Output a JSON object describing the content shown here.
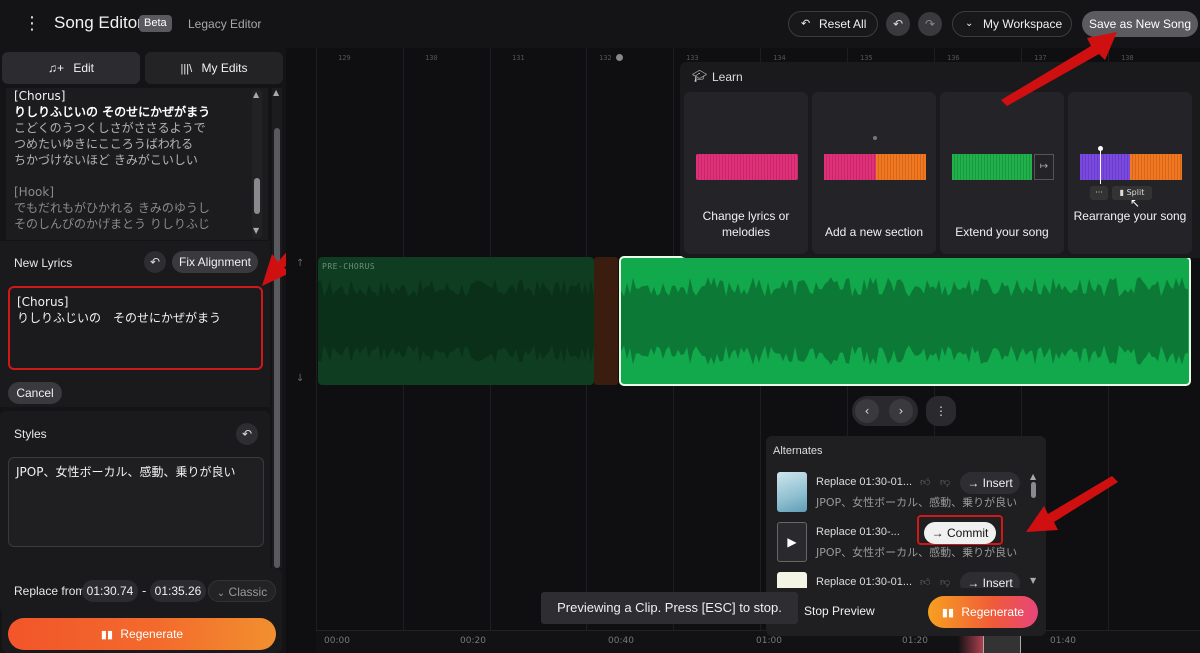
{
  "header": {
    "app_title": "Song Editor",
    "beta_badge": "Beta",
    "legacy_link": "Legacy Editor",
    "reset_all": "Reset All",
    "workspace": "My Workspace",
    "save_new": "Save as New Song"
  },
  "left": {
    "tab_edit": "Edit",
    "tab_my_edits": "My Edits",
    "lyrics": [
      {
        "text": "[Chorus]",
        "style": "active"
      },
      {
        "text": "りしりふじいの そのせにかぜがまう",
        "style": "active-bold"
      },
      {
        "text": "こどくのうつくしさがささるようで",
        "style": "dim"
      },
      {
        "text": "つめたいゆきにこころうばわれる",
        "style": "dim"
      },
      {
        "text": "ちかづけないほど きみがこいしい",
        "style": "dim"
      },
      {
        "text": "",
        "style": "dim"
      },
      {
        "text": "[Hook]",
        "style": "dimmer"
      },
      {
        "text": "でもだれもがひかれる きみのゆうし",
        "style": "dimmer"
      },
      {
        "text": "そのしんぴのかげまとう りしりふじ",
        "style": "dimmer"
      }
    ],
    "new_lyrics_label": "New Lyrics",
    "fix_alignment": "Fix Alignment",
    "new_lyrics_text": "[Chorus]\nりしりふじいの　そのせにかぜがまう",
    "cancel": "Cancel",
    "styles_label": "Styles",
    "styles_text": "JPOP、女性ボーカル、感動、乗りが良い",
    "replace_from_label": "Replace from",
    "replace_start": "01:30.74",
    "replace_dash": "-",
    "replace_end": "01:35.26",
    "mode": "Classic",
    "regenerate": "Regenerate"
  },
  "timeline": {
    "ruler_top": [
      "129",
      "130",
      "131",
      "132",
      "133",
      "134",
      "135",
      "136",
      "137",
      "138"
    ],
    "section_label": "PRE-CHORUS",
    "bottom_ticks": [
      "00:00",
      "00:20",
      "00:40",
      "01:00",
      "01:20",
      "01:40"
    ]
  },
  "learn": {
    "title": "Learn",
    "cards": [
      {
        "label": "Change lyrics or melodies"
      },
      {
        "label": "Add a new section"
      },
      {
        "label": "Extend your song"
      },
      {
        "label": "Rearrange your song"
      }
    ],
    "split_label": "Split"
  },
  "alternates": {
    "title": "Alternates",
    "rows": [
      {
        "title": "Replace 01:30-01...",
        "sub": "JPOP、女性ボーカル、感動、乗りが良い",
        "action": "Insert"
      },
      {
        "title": "Replace 01:30-...",
        "sub": "JPOP、女性ボーカル、感動、乗りが良い",
        "action": "Commit"
      },
      {
        "title": "Replace 01:30-01...",
        "sub": "",
        "action": "Insert"
      }
    ],
    "stop_preview": "Stop Preview",
    "regenerate": "Regenerate"
  },
  "toast": "Previewing a Clip. Press [ESC] to stop.",
  "colors": {
    "accent_orange": "#f05a28",
    "waveform_green": "#12a84c",
    "highlight_red": "#e01010",
    "pink": "#e0307a"
  }
}
